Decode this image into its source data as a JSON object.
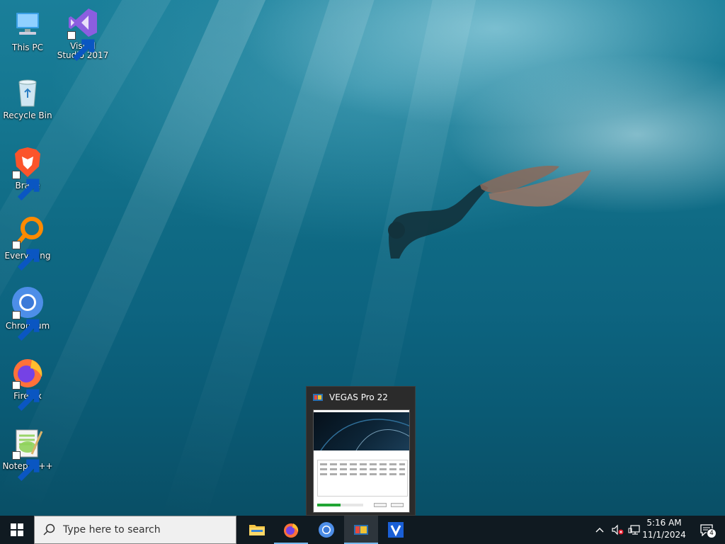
{
  "desktop": {
    "icons": [
      {
        "label": "This PC",
        "icon": "this-pc-icon"
      },
      {
        "label": "Visual Studio 2017",
        "icon": "visual-studio-icon"
      },
      {
        "label": "Recycle Bin",
        "icon": "recycle-bin-icon"
      },
      {
        "label": "Brave",
        "icon": "brave-icon"
      },
      {
        "label": "Everything",
        "icon": "everything-icon"
      },
      {
        "label": "Chromium",
        "icon": "chromium-icon"
      },
      {
        "label": "Firefox",
        "icon": "firefox-icon"
      },
      {
        "label": "Notepad++",
        "icon": "notepad-plus-plus-icon"
      }
    ]
  },
  "thumbnail": {
    "title": "VEGAS Pro 22",
    "progress_fraction": 0.5
  },
  "taskbar": {
    "search_placeholder": "Type here to search",
    "apps": [
      {
        "name": "File Explorer",
        "icon": "file-explorer-icon"
      },
      {
        "name": "Firefox",
        "icon": "firefox-icon"
      },
      {
        "name": "Chromium",
        "icon": "chromium-icon"
      },
      {
        "name": "VEGAS Pro 22",
        "icon": "vegas-pro-icon"
      },
      {
        "name": "VEGAS",
        "icon": "vegas-v-icon"
      }
    ],
    "clock": {
      "time": "5:16 AM",
      "date": "11/1/2024"
    },
    "notification_count": "4"
  },
  "colors": {
    "taskbar": "#101a21",
    "accent": "#76b9ed",
    "progress": "#21a534"
  }
}
